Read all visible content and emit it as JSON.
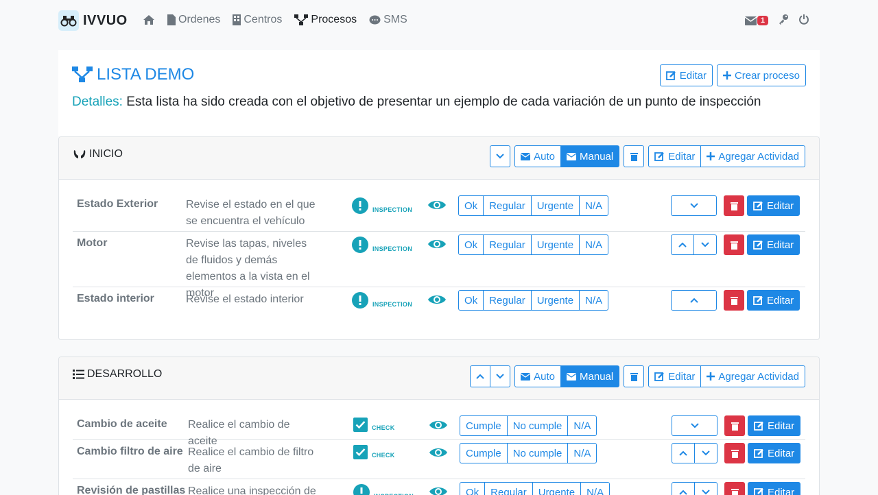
{
  "brand": {
    "name": "IVVUO"
  },
  "nav": {
    "ordenes": "Ordenes",
    "centros": "Centros",
    "procesos": "Procesos",
    "sms": "SMS"
  },
  "notifications": {
    "count": "1"
  },
  "page": {
    "title": "LISTA DEMO",
    "details_label": "Detalles:",
    "details_text": "Esta lista ha sido creada con el objetivo de presentar un ejemplo de cada variación de un punto de inspección",
    "edit_label": "Editar",
    "create_label": "Crear proceso"
  },
  "section_buttons": {
    "auto": "Auto",
    "manual": "Manual",
    "edit": "Editar",
    "add": "Agregar Actividad",
    "row_edit": "Editar"
  },
  "sections": [
    {
      "title": "INICIO",
      "rows": [
        {
          "name": "Estado Exterior",
          "desc": "Revise el estado en el que se encuentra el vehículo",
          "type": "INSPECTION",
          "options": [
            "Ok",
            "Regular",
            "Urgente",
            "N/A"
          ]
        },
        {
          "name": "Motor",
          "desc": "Revise las tapas, niveles de fluidos y demás elementos a la vista en el motor",
          "type": "INSPECTION",
          "options": [
            "Ok",
            "Regular",
            "Urgente",
            "N/A"
          ]
        },
        {
          "name": "Estado interior",
          "desc": "Revise el estado interior",
          "type": "INSPECTION",
          "options": [
            "Ok",
            "Regular",
            "Urgente",
            "N/A"
          ]
        }
      ]
    },
    {
      "title": "DESARROLLO",
      "rows": [
        {
          "name": "Cambio de aceite",
          "desc": "Realice el cambio de aceite",
          "type": "CHECK",
          "options": [
            "Cumple",
            "No cumple",
            "N/A"
          ]
        },
        {
          "name": "Cambio filtro de aire",
          "desc": "Realice el cambio de filtro de aire",
          "type": "CHECK",
          "options": [
            "Cumple",
            "No cumple",
            "N/A"
          ]
        },
        {
          "name": "Revisión de pastillas",
          "desc": "Realice una inspección de",
          "type": "INSPECTION",
          "options": [
            "Ok",
            "Regular",
            "Urgente",
            "N/A"
          ]
        }
      ]
    }
  ],
  "colors": {
    "primary": "#1e88e5",
    "info": "#17a2b8",
    "danger": "#dc3545"
  }
}
